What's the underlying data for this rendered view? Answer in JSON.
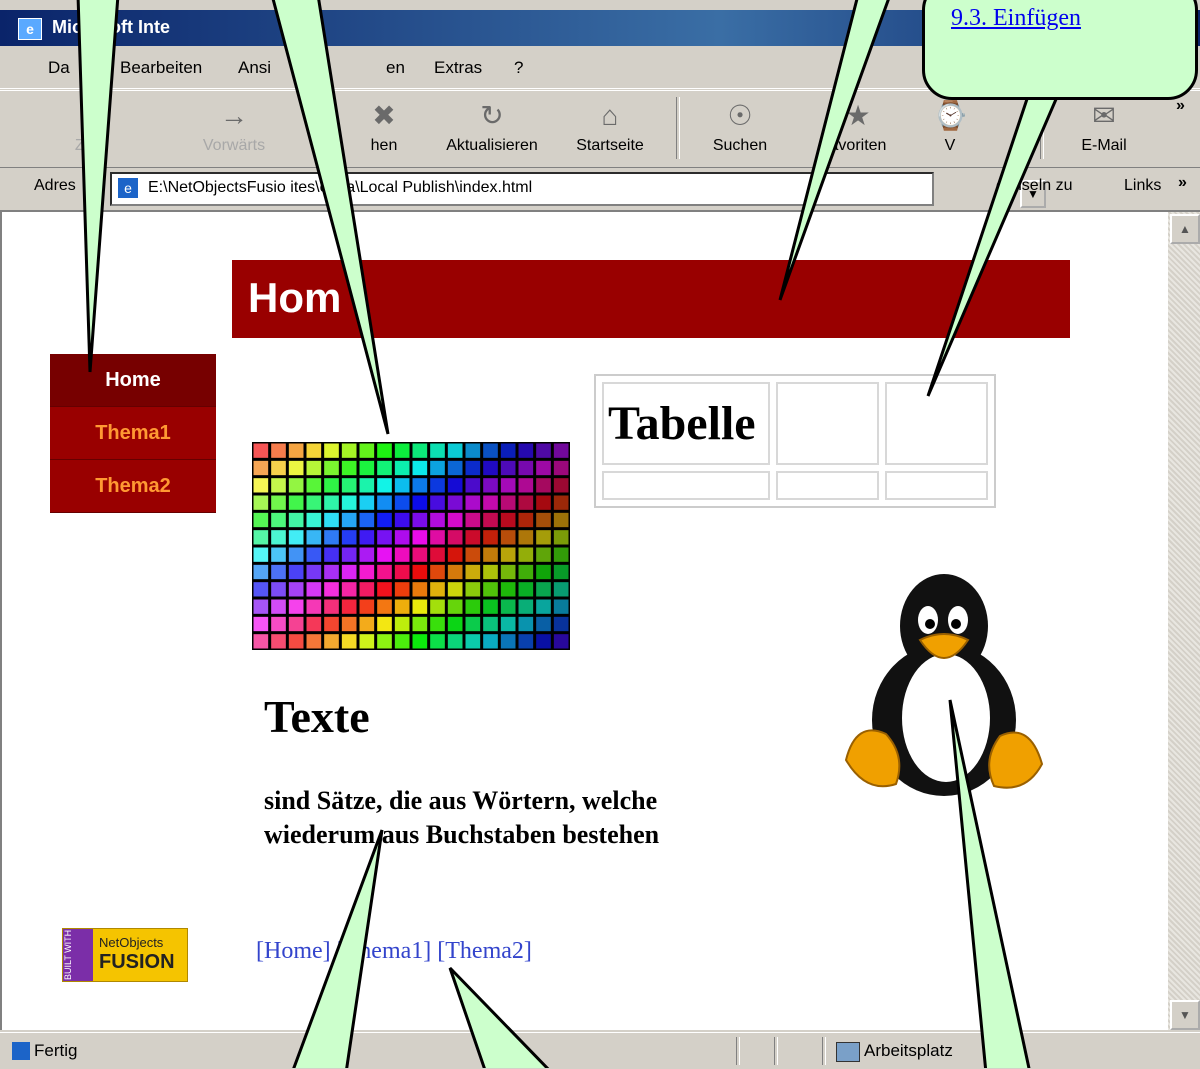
{
  "window": {
    "title_visible": "Microsoft Inte"
  },
  "menu": [
    "Da",
    "Bearbeiten",
    "Ansi",
    "en",
    "Extras",
    "?"
  ],
  "toolbar": {
    "buttons": [
      {
        "label": "Zurück",
        "visible": "Z  ck",
        "icon": "back-arrow-icon"
      },
      {
        "label": "Vorwärts",
        "visible": "Vorwärts",
        "icon": "forward-arrow-icon"
      },
      {
        "label": "hen",
        "visible": "hen",
        "icon": "stop-icon"
      },
      {
        "label": "Aktualisieren",
        "visible": "Aktualisieren",
        "icon": "refresh-icon"
      },
      {
        "label": "Startseite",
        "visible": "Startseite",
        "icon": "home-icon"
      },
      {
        "label": "Suchen",
        "visible": "Suchen",
        "icon": "search-icon"
      },
      {
        "label": "avoriten",
        "visible": "avoriten",
        "icon": "favorites-icon"
      },
      {
        "label": "V",
        "visible": "V",
        "icon": "history-icon"
      },
      {
        "label": "E-Mail",
        "visible": "E-Mail",
        "icon": "mail-icon"
      }
    ],
    "more": "»"
  },
  "address": {
    "label": "Adres",
    "value": "E:\\NetObjectsFusio    ites\\extra\\Local Publish\\index.html",
    "go_label": "echseln zu",
    "links_label": "Links"
  },
  "page": {
    "banner_title": "Hom",
    "nav": [
      "Home",
      "Thema1",
      "Thema2"
    ],
    "table_header": "Tabelle",
    "heading": "Texte",
    "paragraph_line1": "sind Sätze, die aus Wörtern, welche",
    "paragraph_line2": "wiederum aus Buchstaben bestehen",
    "footer_links": [
      "[Home]",
      "[Thema1]",
      "[Thema2]"
    ],
    "badge_side": "BUILT WITH",
    "badge_top": "NetObjects",
    "badge_bottom": "FUSION"
  },
  "status": {
    "left": "Fertig",
    "zone": "Arbeitsplatz"
  },
  "callout": {
    "link_text": "9.3. Einfügen",
    "color": "#ccffcc"
  },
  "colors": {
    "banner": "#990000",
    "nav_active": "#770000",
    "nav_text": "#ff9933"
  }
}
